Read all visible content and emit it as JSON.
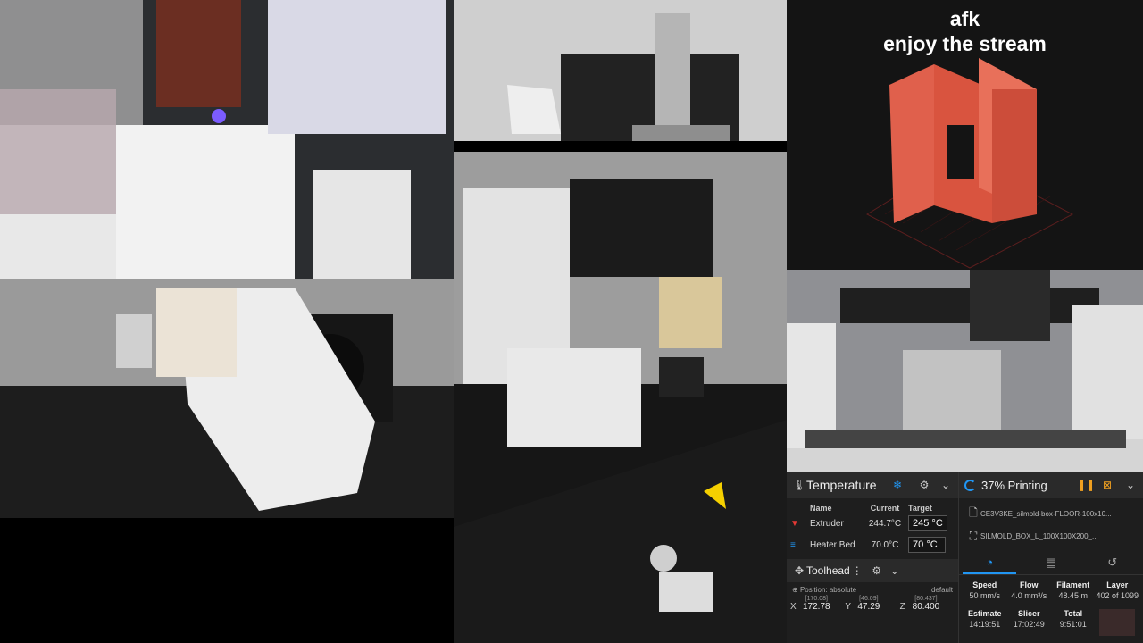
{
  "overlay": {
    "line1": "afk",
    "line2": "enjoy the stream"
  },
  "temperature": {
    "title": "Temperature",
    "columns": {
      "name": "Name",
      "current": "Current",
      "target": "Target"
    },
    "rows": [
      {
        "name": "Extruder",
        "current": "244.7°C",
        "target": "245",
        "unit": "°C"
      },
      {
        "name": "Heater Bed",
        "current": "70.0°C",
        "target": "70",
        "unit": "°C"
      }
    ]
  },
  "toolhead": {
    "title": "Toolhead",
    "position_label": "Position: absolute",
    "mode_label": "default",
    "axes": [
      {
        "axis": "X",
        "requested": "[170.08]",
        "value": "172.78"
      },
      {
        "axis": "Y",
        "requested": "[46.09]",
        "value": "47.29"
      },
      {
        "axis": "Z",
        "requested": "[80.437]",
        "value": "80.400"
      }
    ]
  },
  "status": {
    "title": "37% Printing",
    "progress_percent": 37,
    "file": "CE3V3KE_silmold-box-FLOOR-100x10...",
    "object": "SILMOLD_BOX_L_100X100X200_...",
    "stats_row1": [
      {
        "label": "Speed",
        "value": "50 mm/s"
      },
      {
        "label": "Flow",
        "value": "4.0 mm³/s"
      },
      {
        "label": "Filament",
        "value": "48.45 m"
      },
      {
        "label": "Layer",
        "value": "402 of 1099"
      }
    ],
    "stats_row2": [
      {
        "label": "Estimate",
        "value": "14:19:51"
      },
      {
        "label": "Slicer",
        "value": "17:02:49"
      },
      {
        "label": "Total",
        "value": "9:51:01"
      }
    ]
  },
  "icons": {
    "snowflake": "snowflake-icon",
    "gear": "gear-icon",
    "chevron": "chevron-down-icon",
    "pause": "pause-icon",
    "stop": "stop-icon",
    "file": "file-icon",
    "object": "object-icon",
    "gauge": "gauge-icon",
    "document": "document-icon",
    "history": "history-icon",
    "move": "move-icon",
    "thermometer": "thermometer-icon",
    "bed": "bed-icon"
  },
  "colors": {
    "accent": "#2196f3",
    "warning": "#f0a020",
    "model": "#e8604c"
  }
}
